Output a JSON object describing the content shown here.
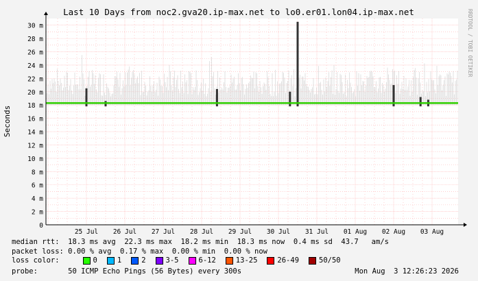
{
  "chart_data": {
    "type": "area",
    "title": "Last 10 Days from noc2.gva20.ip-max.net to lo0.er01.lon04.ip-max.net",
    "ylabel": "Seconds",
    "y_ticks": [
      "0",
      "2 m",
      "4 m",
      "6 m",
      "8 m",
      "10 m",
      "12 m",
      "14 m",
      "16 m",
      "18 m",
      "20 m",
      "22 m",
      "24 m",
      "26 m",
      "28 m",
      "30 m"
    ],
    "y_unit": "ms",
    "ylim": [
      0,
      31
    ],
    "x_ticks": [
      "25 Jul",
      "26 Jul",
      "27 Jul",
      "28 Jul",
      "29 Jul",
      "30 Jul",
      "31 Jul",
      "01 Aug",
      "02 Aug",
      "03 Aug"
    ],
    "median_rtt_ms": 18.3,
    "spikes": [
      {
        "day": 1.0,
        "value": 20.5
      },
      {
        "day": 1.5,
        "value": 18.6
      },
      {
        "day": 4.4,
        "value": 20.4
      },
      {
        "day": 6.3,
        "value": 20.0
      },
      {
        "day": 6.5,
        "value": 30.5
      },
      {
        "day": 9.0,
        "value": 21.0
      },
      {
        "day": 9.7,
        "value": 19.2
      },
      {
        "day": 9.9,
        "value": 18.8
      }
    ],
    "grid": true,
    "watermark": "RRDTOOL / TOBI OETIKER"
  },
  "stats": {
    "median_rtt": "median rtt:  18.3 ms avg  22.3 ms max  18.2 ms min  18.3 ms now  0.4 ms sd  43.7   am/s",
    "packet_loss": "packet loss: 0.00 % avg  0.17 % max  0.00 % min  0.00 % now",
    "loss_color_label": "loss color:",
    "probe": "probe:       50 ICMP Echo Pings (56 Bytes) every 300s",
    "timestamp": "Mon Aug  3 12:26:23 2026"
  },
  "loss_legend": [
    {
      "label": "0",
      "color": "#26ff00"
    },
    {
      "label": "1",
      "color": "#00b8ff"
    },
    {
      "label": "2",
      "color": "#0059ff"
    },
    {
      "label": "3-5",
      "color": "#7e00ff"
    },
    {
      "label": "6-12",
      "color": "#ff00ff"
    },
    {
      "label": "13-25",
      "color": "#ff5500"
    },
    {
      "label": "26-49",
      "color": "#ff0000"
    },
    {
      "label": "50/50",
      "color": "#a10000"
    }
  ],
  "colors": {
    "plot_bg": "#ffffff",
    "grid": "#ffb0b0",
    "median": "#2fd000",
    "smoke": "#cfcfcf"
  }
}
